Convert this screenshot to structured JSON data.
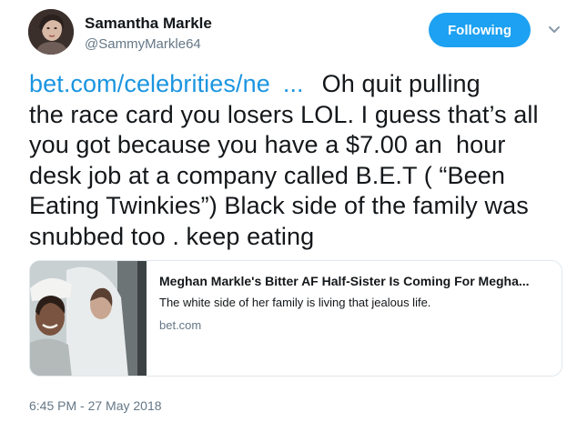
{
  "header": {
    "display_name": "Samantha Markle",
    "handle": "@SammyMarkle64",
    "follow_label": "Following",
    "menu_icon": "chevron-down-icon",
    "avatar_icon": "avatar"
  },
  "tweet": {
    "link_text": "bet.com/celebrities/ne",
    "link_ellipsis": "...",
    "line1": "Oh quit pulling",
    "line2": "the race card you losers LOL. I guess that’s all",
    "line3": "you got because you have a $7.00 an  hour",
    "line4": "desk job at a company called B.E.T ( “Been",
    "line5": "Eating Twinkies”) Black side of the family was",
    "line6": "snubbed too . keep eating"
  },
  "card": {
    "title": "Meghan Markle's Bitter AF Half-Sister Is Coming For Megha...",
    "description": "The white side of her family is living that jealous life.",
    "domain": "bet.com"
  },
  "timestamp": "6:45 PM - 27 May 2018",
  "colors": {
    "accent": "#1da1f2",
    "link": "#1b95e0",
    "secondary_text": "#657786",
    "border": "#e1e8ed"
  }
}
